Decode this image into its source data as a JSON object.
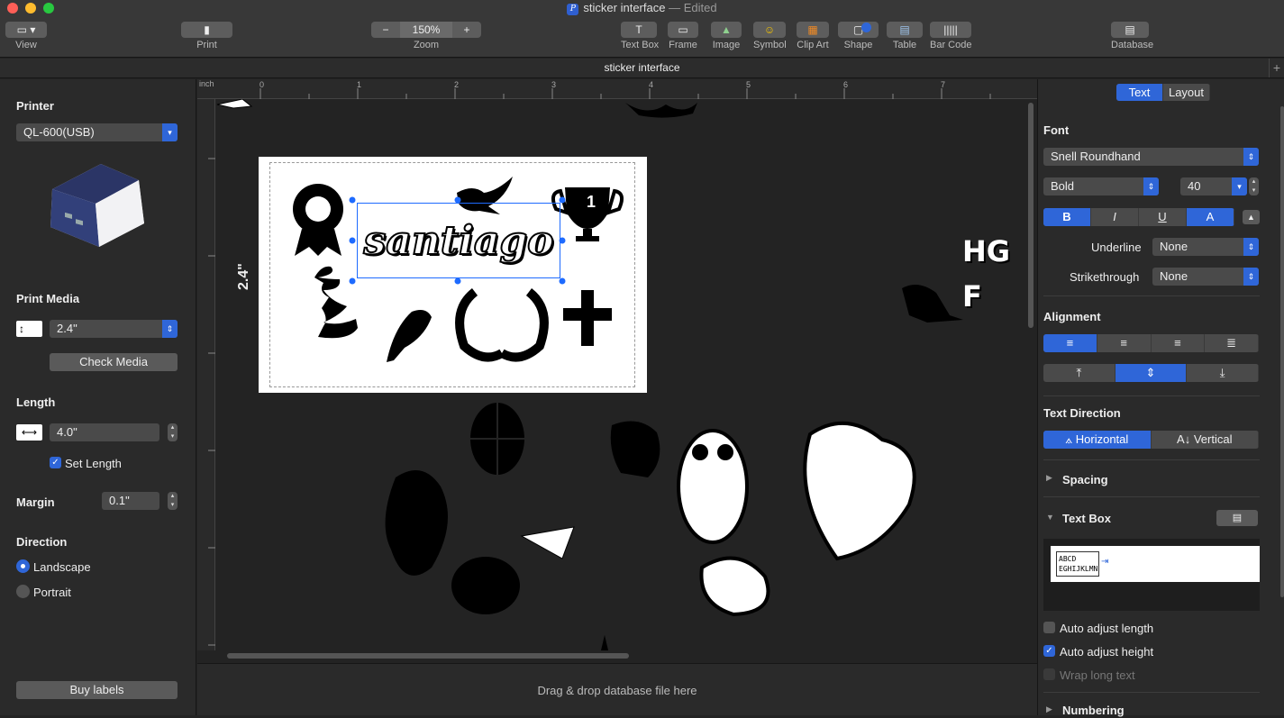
{
  "window": {
    "title": "sticker interface",
    "edited": "— Edited"
  },
  "toolbar": {
    "view_label": "View",
    "print_label": "Print",
    "zoom_label": "Zoom",
    "zoom_value": "150%",
    "zoom_minus": "−",
    "zoom_plus": "+",
    "text_box": "Text Box",
    "frame": "Frame",
    "image": "Image",
    "symbol": "Symbol",
    "clip_art": "Clip Art",
    "shape": "Shape",
    "table": "Table",
    "bar_code": "Bar Code",
    "database": "Database"
  },
  "tab": {
    "title": "sticker interface",
    "add": "+"
  },
  "left": {
    "printer_heading": "Printer",
    "printer_value": "QL-600(USB)",
    "media_heading": "Print Media",
    "media_value": "2.4\"",
    "check_media": "Check Media",
    "length_heading": "Length",
    "length_value": "4.0\"",
    "set_length": "Set Length",
    "margin_heading": "Margin",
    "margin_value": "0.1\"",
    "direction_heading": "Direction",
    "landscape": "Landscape",
    "portrait": "Portrait",
    "buy_labels": "Buy labels"
  },
  "ruler": {
    "unit": "inch",
    "marks": [
      "0",
      "1",
      "2",
      "3",
      "4",
      "5",
      "6",
      "7"
    ]
  },
  "canvas": {
    "label_text": "santiago",
    "height_label": "2.4\"",
    "hg": "HG",
    "f": "F",
    "trophy_num": "1"
  },
  "dropzone": "Drag & drop database file here",
  "right": {
    "tab_text": "Text",
    "tab_layout": "Layout",
    "font_heading": "Font",
    "font_family": "Snell Roundhand",
    "font_style": "Bold",
    "font_size": "40",
    "fmt_bold": "B",
    "fmt_italic": "I",
    "fmt_underline": "U",
    "fmt_outline": "A",
    "underline_label": "Underline",
    "underline_value": "None",
    "strike_label": "Strikethrough",
    "strike_value": "None",
    "alignment_heading": "Alignment",
    "direction_heading": "Text Direction",
    "horizontal": "Horizontal",
    "vertical": "Vertical",
    "spacing_heading": "Spacing",
    "textbox_heading": "Text Box",
    "preview_line1": "ABCD",
    "preview_line2": "EGHIJKLMN",
    "auto_length": "Auto adjust length",
    "auto_height": "Auto adjust height",
    "wrap": "Wrap long text",
    "numbering_heading": "Numbering"
  },
  "colors": {
    "accent": "#2f66d8",
    "handles": "#1e6bff"
  }
}
